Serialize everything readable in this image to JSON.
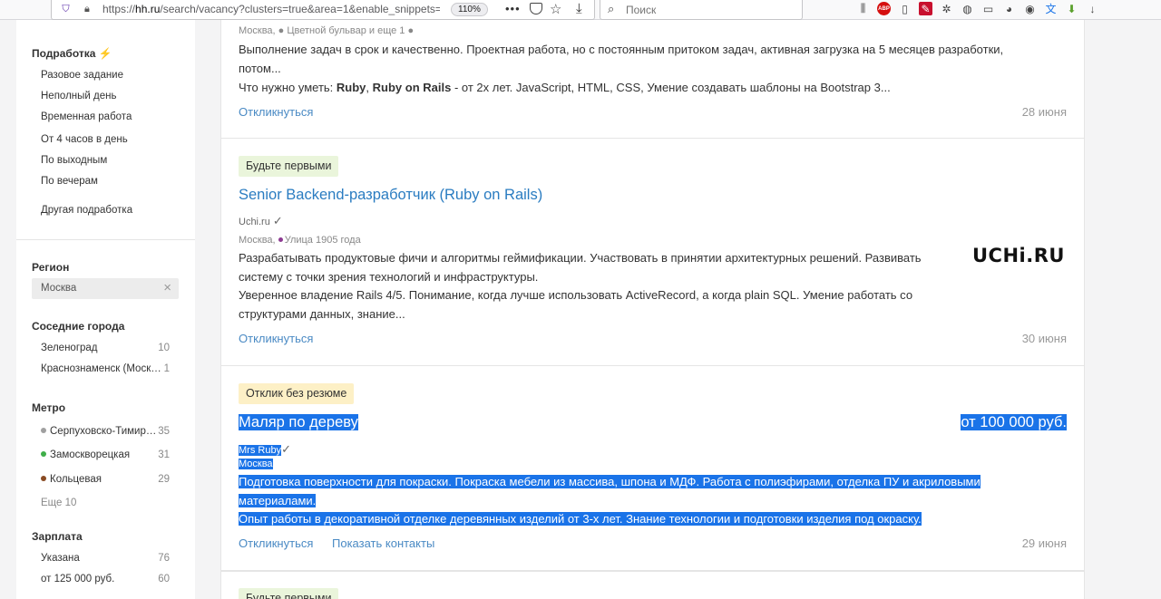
{
  "browser": {
    "url_prefix": "https://",
    "url_host": "hh.ru",
    "url_path": "/search/vacancy?clusters=true&area=1&enable_snippets=",
    "zoom": "110%",
    "search_placeholder": "Поиск",
    "abp_badge": "ABP"
  },
  "sidebar": {
    "work_type": {
      "title": "Подработка",
      "items": [
        "Разовое задание",
        "Неполный день",
        "Временная работа",
        "От 4 часов в день",
        "По выходным",
        "По вечерам"
      ],
      "other": "Другая подработка"
    },
    "region": {
      "title": "Регион",
      "value": "Москва"
    },
    "nearby": {
      "title": "Соседние города",
      "items": [
        {
          "label": "Зеленоград",
          "count": "10"
        },
        {
          "label": "Краснознаменск (Моск…",
          "count": "1"
        }
      ]
    },
    "metro": {
      "title": "Метро",
      "items": [
        {
          "label": "Серпуховско-Тимир…",
          "count": "35",
          "color": "#a0a0a0"
        },
        {
          "label": "Замоскворецкая",
          "count": "31",
          "color": "#3fae49"
        },
        {
          "label": "Кольцевая",
          "count": "29",
          "color": "#8a4b23"
        }
      ],
      "more": "Еще 10"
    },
    "salary": {
      "title": "Зарплата",
      "items": [
        {
          "label": "Указана",
          "count": "76"
        },
        {
          "label": "от 125 000 руб.",
          "count": "60"
        }
      ]
    }
  },
  "vacancies": [
    {
      "meta": "Москва, ● Цветной бульвар и еще 1 ●",
      "desc1": "Выполнение задач в срок и качественно. Проектная работа, но с постоянным притоком задач, активная загрузка на 5 месяцев разработки, потом...",
      "desc2_pre": "Что нужно уметь: ",
      "desc2_b1": "Ruby",
      "desc2_sep": ", ",
      "desc2_b2": "Ruby on Rails",
      "desc2_post": " - от 2х лет. JavaScript, HTML, CSS, Умение создавать шаблоны на Bootstrap 3...",
      "respond": "Откликнуться",
      "date": "28 июня"
    },
    {
      "badge": "Будьте первыми",
      "title": "Senior Backend-разработчик (Ruby on Rails)",
      "company": "Uchi.ru",
      "location": "Москва,",
      "metro": "Улица 1905 года",
      "desc1": "Разрабатывать продуктовые фичи и алгоритмы геймификации. Участвовать в принятии архитектурных решений. Развивать систему с точки зрения технологий и инфраструктуры.",
      "desc2": "Уверенное владение Rails 4/5. Понимание, когда лучше использовать ActiveRecord, а когда plain SQL. Умение работать со структурами данных, знание...",
      "logo": "UCHi.RU",
      "respond": "Откликнуться",
      "date": "30 июня"
    },
    {
      "badge": "Отклик без резюме",
      "title": "Маляр по дереву",
      "salary": "от 100 000 руб.",
      "company": "Mrs Ruby",
      "location": "Москва",
      "desc1_a": "Подготовка поверхности для покраски. Покраска мебели из массива, шпона и МДФ. Работа с полиэфирами, отделка ПУ и акриловыми",
      "desc1_b": "материалами.",
      "desc2": "Опыт работы в декоративной отделке деревянных изделий от 3-х лет. Знание технологии и подготовки изделия под окраску.",
      "respond": "Откликнуться",
      "contacts": "Показать контакты",
      "date": "29 июня"
    },
    {
      "badge": "Будьте первыми"
    }
  ],
  "colors": {
    "link": "#2a7cc1",
    "selection": "#1a73e8",
    "badge_green": "#eaf5db",
    "badge_yellow": "#fdf0c6"
  }
}
